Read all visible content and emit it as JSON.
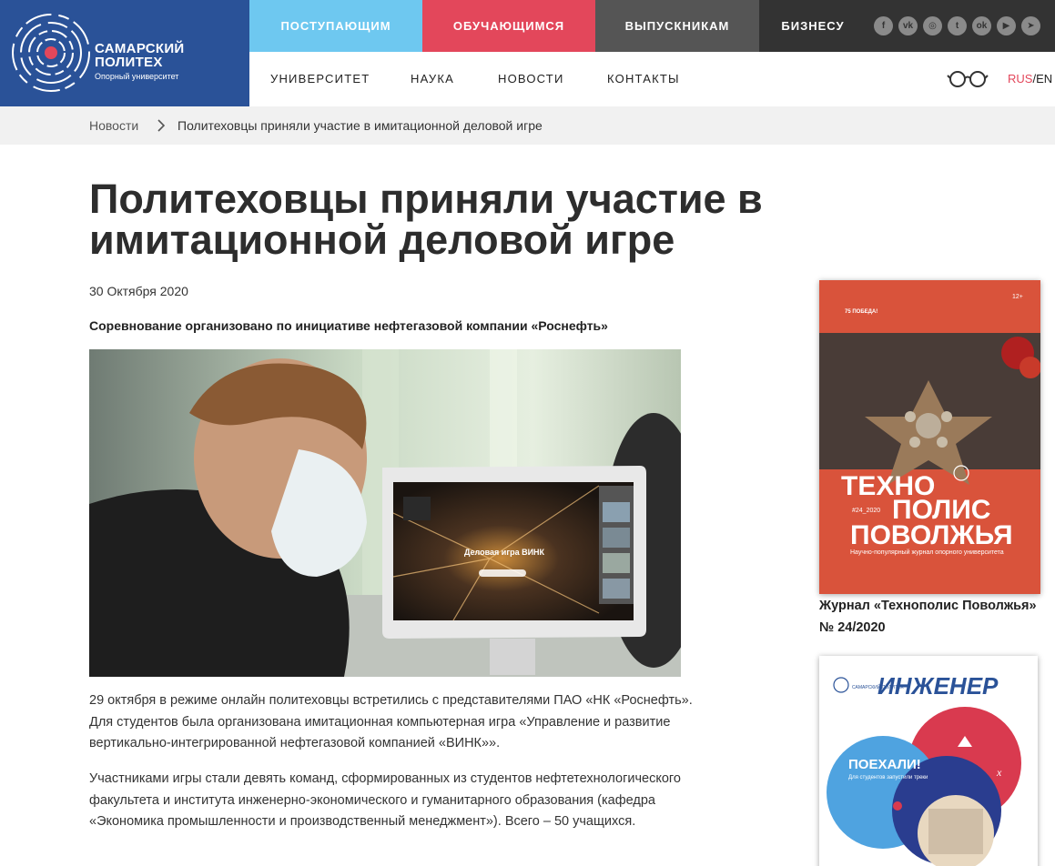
{
  "brand": {
    "name_line1": "САМАРСКИЙ",
    "name_line2": "ПОЛИТЕХ",
    "tagline": "Опорный университет",
    "color": "#2a5298"
  },
  "top_nav": [
    {
      "label": "ПОСТУПАЮЩИМ",
      "color": "#6ec8f0"
    },
    {
      "label": "ОБУЧАЮЩИМСЯ",
      "color": "#e3475b"
    },
    {
      "label": "ВЫПУСКНИКАМ",
      "color": "#555555"
    },
    {
      "label": "БИЗНЕСУ",
      "color": "#333333"
    }
  ],
  "social": [
    {
      "icon": "facebook-icon",
      "glyph": "f"
    },
    {
      "icon": "vk-icon",
      "glyph": "vk"
    },
    {
      "icon": "instagram-icon",
      "glyph": "◎"
    },
    {
      "icon": "twitter-icon",
      "glyph": "t"
    },
    {
      "icon": "odnoklassniki-icon",
      "glyph": "ok"
    },
    {
      "icon": "youtube-icon",
      "glyph": "▶"
    },
    {
      "icon": "telegram-icon",
      "glyph": "➤"
    }
  ],
  "sub_nav": [
    "УНИВЕРСИТЕТ",
    "НАУКА",
    "НОВОСТИ",
    "КОНТАКТЫ"
  ],
  "lang": {
    "ru": "RUS",
    "sep": "/",
    "en": "EN"
  },
  "breadcrumb": {
    "home": "Новости",
    "current": "Политеховцы приняли участие в имитационной деловой игре"
  },
  "article": {
    "title": "Политеховцы приняли участие в имитационной деловой игре",
    "date": "30 Октября 2020",
    "lead": "Соревнование организовано по инициативе нефтегазовой компании «Роснефть»",
    "photo_screen_text": "Деловая игра ВИНК",
    "paragraphs": [
      "29 октября в режиме онлайн политеховцы встретились с представителями ПАО «НК «Роснефть». Для студентов была организована имитационная компьютерная игра «Управление и развитие вертикально-интегрированной нефтегазовой компанией «ВИНК»».",
      "Участниками игры стали девять команд, сформированных из студентов нефтетехнологического факультета и института инженерно-экономического и гуманитарного образования (кафедра «Экономика промышленности и производственный менеджмент»). Всего – 50 учащихся."
    ]
  },
  "sidebar": {
    "magazine1": {
      "age": "12+",
      "line1": "ТЕХНО",
      "line2": "ПОЛИС",
      "line3": "ПОВОЛЖЬЯ",
      "issue": "#24_2020",
      "subtitle": "Научно-популярный журнал опорного университета",
      "caption": "Журнал «Технополис Поволжья» № 24/2020"
    },
    "magazine2": {
      "title": "ИНЖЕНЕР",
      "headline": "ПОЕХАЛИ!",
      "subhead": "Для студентов запустили треки"
    }
  }
}
